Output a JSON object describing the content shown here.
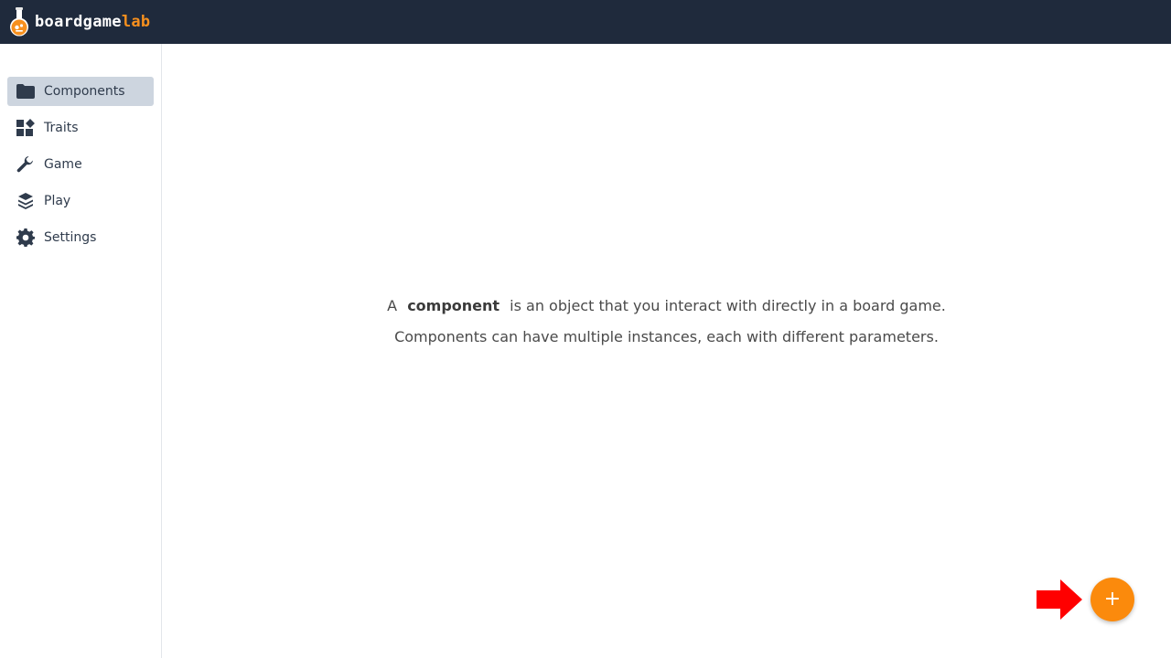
{
  "header": {
    "logo_part1": "boardgame",
    "logo_part2": "lab",
    "background": "#1f2a3c",
    "accent": "#f7901e"
  },
  "sidebar": {
    "items": [
      {
        "label": "Components",
        "icon": "folder-icon",
        "active": true
      },
      {
        "label": "Traits",
        "icon": "widgets-icon",
        "active": false
      },
      {
        "label": "Game",
        "icon": "wrench-icon",
        "active": false
      },
      {
        "label": "Play",
        "icon": "layers-icon",
        "active": false
      },
      {
        "label": "Settings",
        "icon": "gear-icon",
        "active": false
      }
    ]
  },
  "main": {
    "intro_prefix": "A",
    "intro_bold": "component",
    "intro_suffix": "is an object that you interact with directly in a board game.",
    "intro_line2": "Components can have multiple instances, each with different parameters."
  },
  "fab": {
    "label": "+",
    "icon": "plus-icon",
    "color": "#fb8a0c"
  },
  "annotation": {
    "icon": "arrow-right-icon",
    "color": "#ff0000"
  }
}
